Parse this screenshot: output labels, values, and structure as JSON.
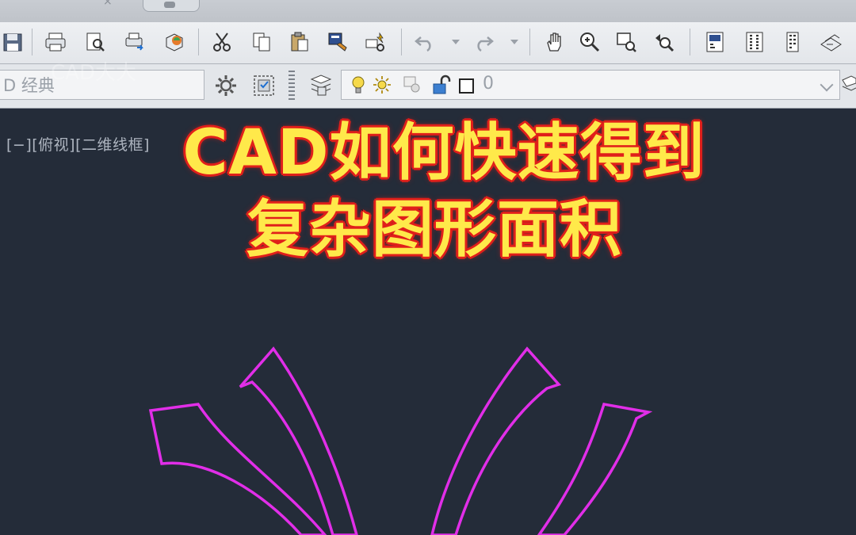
{
  "toolbar": {
    "icons": [
      "save-icon",
      "print-icon",
      "print-preview-icon",
      "plot-icon",
      "publish-3d-icon",
      "cut-icon",
      "copy-icon",
      "paste-icon",
      "match-properties-icon",
      "block-editor-icon",
      "undo-icon",
      "redo-icon",
      "pan-icon",
      "zoom-realtime-icon",
      "zoom-window-icon",
      "zoom-previous-icon",
      "properties-icon",
      "design-center-icon",
      "tool-palettes-icon",
      "sheet-set-icon"
    ]
  },
  "workspace": {
    "name": "D 经典",
    "watermark": "CAD大大"
  },
  "layer": {
    "current": "0"
  },
  "viewport": {
    "label": "[−][俯视][二维线框]"
  },
  "overlay": {
    "line1": "CAD如何快速得到",
    "line2": "复杂图形面积"
  },
  "colors": {
    "canvas_bg": "#242c39",
    "shape_stroke": "#e12ee8",
    "headline_fill": "#ffe94a",
    "headline_outline": "#e0201b"
  }
}
